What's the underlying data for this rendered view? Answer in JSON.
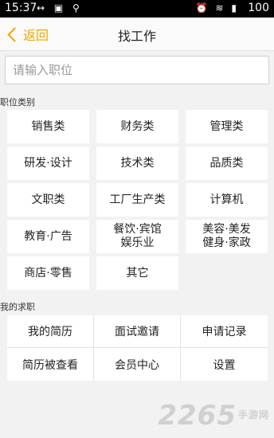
{
  "status_bar": {
    "time": "15:37",
    "left_icons": "↔ ▣ ⚲",
    "right_icons": "⏰ ≋ ▮",
    "battery": "100"
  },
  "nav": {
    "back_label": "返回",
    "title": "找工作"
  },
  "search": {
    "placeholder": "请输入职位"
  },
  "categories_section": {
    "label": "职位类别",
    "items": [
      {
        "l1": "销售类",
        "l2": ""
      },
      {
        "l1": "财务类",
        "l2": ""
      },
      {
        "l1": "管理类",
        "l2": ""
      },
      {
        "l1": "研发·设计",
        "l2": ""
      },
      {
        "l1": "技术类",
        "l2": ""
      },
      {
        "l1": "品质类",
        "l2": ""
      },
      {
        "l1": "文职类",
        "l2": ""
      },
      {
        "l1": "工厂生产类",
        "l2": ""
      },
      {
        "l1": "计算机",
        "l2": ""
      },
      {
        "l1": "教育·广告",
        "l2": ""
      },
      {
        "l1": "餐饮·宾馆",
        "l2": "娱乐业"
      },
      {
        "l1": "美容·美发",
        "l2": "健身·家政"
      },
      {
        "l1": "商店·零售",
        "l2": ""
      },
      {
        "l1": "其它",
        "l2": ""
      }
    ]
  },
  "my_section": {
    "label": "我的求职",
    "items": [
      "我的简历",
      "面试邀请",
      "申请记录",
      "简历被查看",
      "会员中心",
      "设置"
    ]
  },
  "watermark": {
    "brand": "2265",
    "site": "手游网"
  }
}
